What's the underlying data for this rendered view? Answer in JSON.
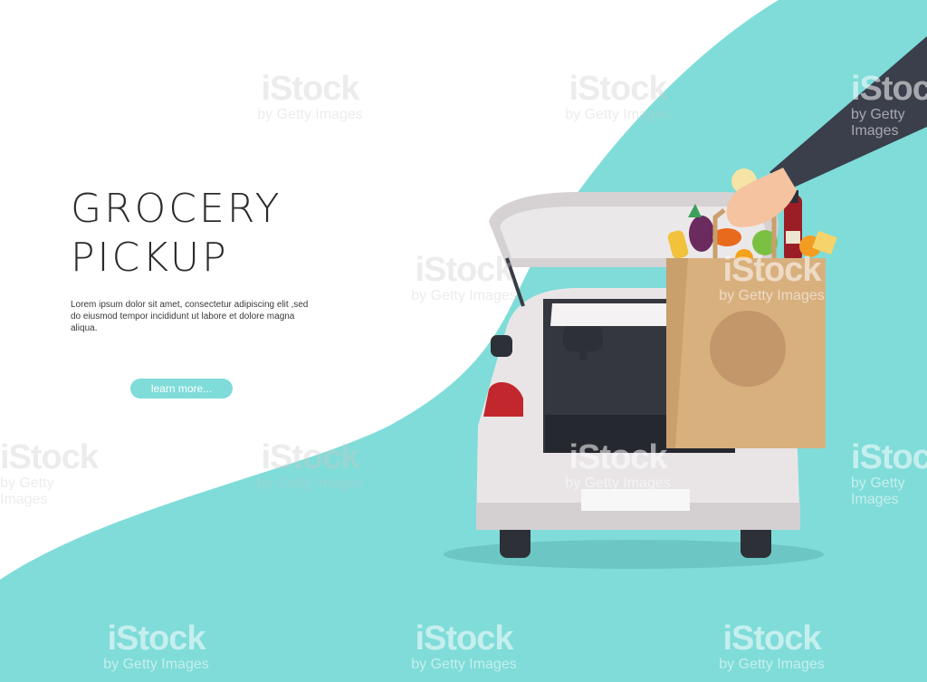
{
  "hero": {
    "title_line1": "GROCERY",
    "title_line2": "PICKUP",
    "description": "Lorem ipsum dolor sit amet, consectetur adipiscing elit ,sed do eiusmod tempor incididunt ut labore et dolore magna aliqua.",
    "button_label": "learn more..."
  },
  "watermark": {
    "brand": "iStock",
    "byline": "by Getty Images"
  },
  "colors": {
    "accent": "#7fdcd9",
    "background": "#ffffff",
    "title": "#2b2b2b",
    "car_body": "#e9e5e6",
    "bag": "#d8b07e",
    "sleeve": "#3a3f4b",
    "taillight": "#c2272d"
  }
}
